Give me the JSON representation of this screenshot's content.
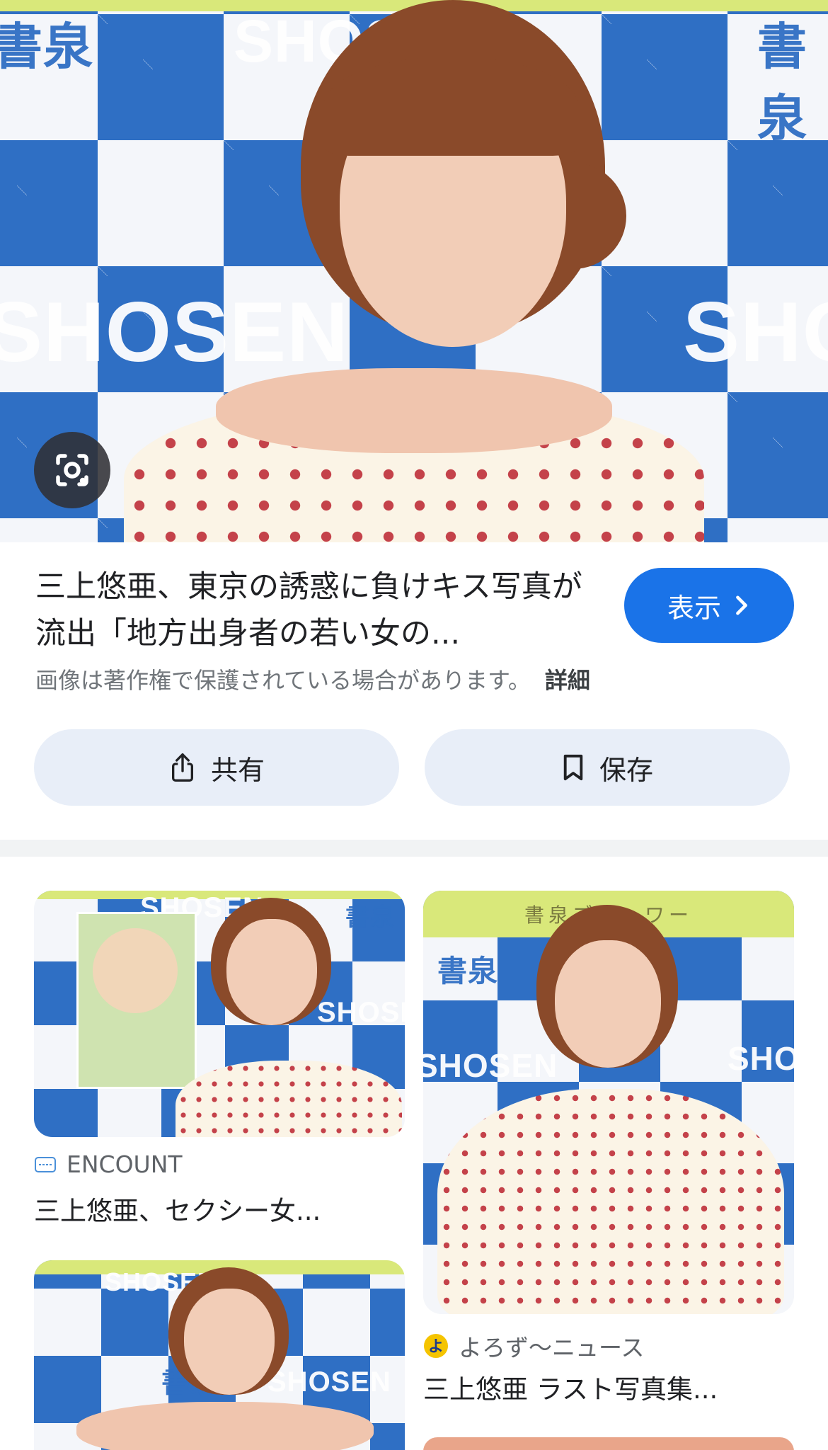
{
  "hero": {
    "watermarks": [
      "SHOSEN",
      "SHOSEN",
      "SHOSEN",
      "書泉",
      "書泉"
    ],
    "lens_icon": "google-lens-icon"
  },
  "result": {
    "title": "三上悠亜、東京の誘惑に負けキス写真が流出「地方出身者の若い女の...",
    "visit_label": "表示",
    "copyright_note": "画像は著作権で保護されている場合があります。",
    "details_label": "詳細"
  },
  "actions": {
    "share_label": "共有",
    "save_label": "保存"
  },
  "related": [
    {
      "source": "ENCOUNT",
      "title": "三上悠亜、セクシー女...",
      "watermarks": [
        "SHOSEN",
        "書泉",
        "SHOSEN"
      ]
    },
    {
      "source": "よろず〜ニュース",
      "title": "三上悠亜 ラスト写真集...",
      "topbar_text": "書泉ブ　　ワー",
      "watermarks": [
        "書泉",
        "SHOSEN",
        "SHOSEN"
      ]
    },
    {
      "watermarks": [
        "SHOSEN",
        "書泉",
        "SHOSEN"
      ]
    }
  ],
  "colors": {
    "accent": "#1a73e8",
    "pill": "#e8eef8",
    "backdrop_blue": "#2f6fc4"
  }
}
